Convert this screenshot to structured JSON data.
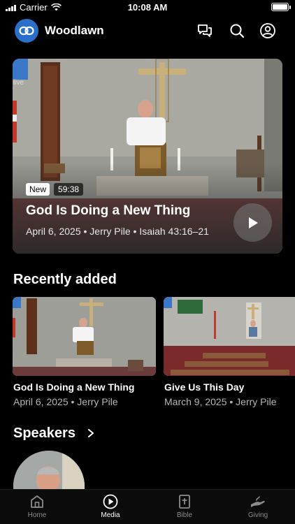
{
  "status_bar": {
    "carrier": "Carrier",
    "time": "10:08 AM"
  },
  "header": {
    "title": "Woodlawn"
  },
  "hero": {
    "badge_new": "New",
    "duration": "59:38",
    "title": "God Is Doing a New Thing",
    "meta": "April 6, 2025 • Jerry Pile • Isaiah 43:16–21",
    "overlay_label": "live"
  },
  "recently_added": {
    "heading": "Recently added",
    "items": [
      {
        "title": "God Is Doing a New Thing",
        "meta": "April 6, 2025 • Jerry Pile"
      },
      {
        "title": "Give Us This Day",
        "meta": "March 9, 2025 • Jerry Pile"
      }
    ]
  },
  "speakers": {
    "heading": "Speakers"
  },
  "tabs": [
    {
      "label": "Home",
      "icon": "home-icon",
      "active": false
    },
    {
      "label": "Media",
      "icon": "play-circle-icon",
      "active": true
    },
    {
      "label": "Bible",
      "icon": "bible-icon",
      "active": false
    },
    {
      "label": "Giving",
      "icon": "giving-hand-icon",
      "active": false
    }
  ],
  "colors": {
    "background": "#000000",
    "accent_logo": "#2a6fc9",
    "tab_inactive": "#8c8c8c",
    "tab_active": "#ffffff"
  }
}
